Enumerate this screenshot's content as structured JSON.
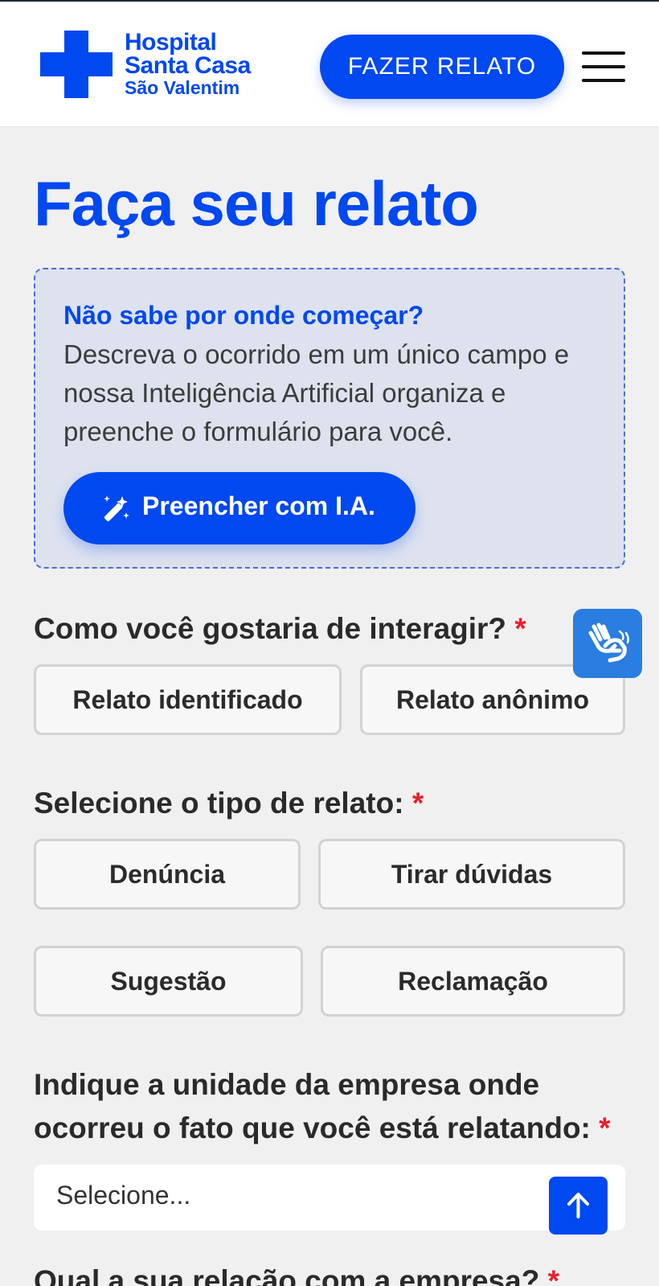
{
  "header": {
    "logo": {
      "line1": "Hospital",
      "line2": "Santa Casa",
      "line3": "São Valentim",
      "color": "#0048f0"
    },
    "cta_label": "FAZER RELATO",
    "menu_icon": "hamburger-menu-icon"
  },
  "page": {
    "title": "Faça seu relato"
  },
  "ai_box": {
    "question": "Não sabe por onde começar?",
    "description": "Descreva o ocorrido em um único campo e nossa Inteligência Artificial organiza e preenche o formulário para você.",
    "button_label": "Preencher com I.A.",
    "button_icon": "magic-wand-icon"
  },
  "interaction": {
    "label": "Como você gostaria de interagir?",
    "required_mark": "*",
    "options": [
      "Relato identificado",
      "Relato anônimo"
    ]
  },
  "report_type": {
    "label": "Selecione o tipo de relato:",
    "required_mark": "*",
    "options": [
      "Denúncia",
      "Tirar dúvidas",
      "Sugestão",
      "Reclamação"
    ]
  },
  "unit": {
    "label": "Indique a unidade da empresa onde ocorreu o fato que você está relatando:",
    "required_mark": "*",
    "placeholder": "Selecione..."
  },
  "relation": {
    "label": "Qual a sua relação com a empresa?",
    "required_mark": "*"
  },
  "floating": {
    "accessibility_icon": "sign-language-hands-icon",
    "scroll_top_icon": "arrow-up-icon"
  },
  "colors": {
    "primary": "#0048f0",
    "required": "#e8202a",
    "accessibility": "#2a7de1"
  }
}
